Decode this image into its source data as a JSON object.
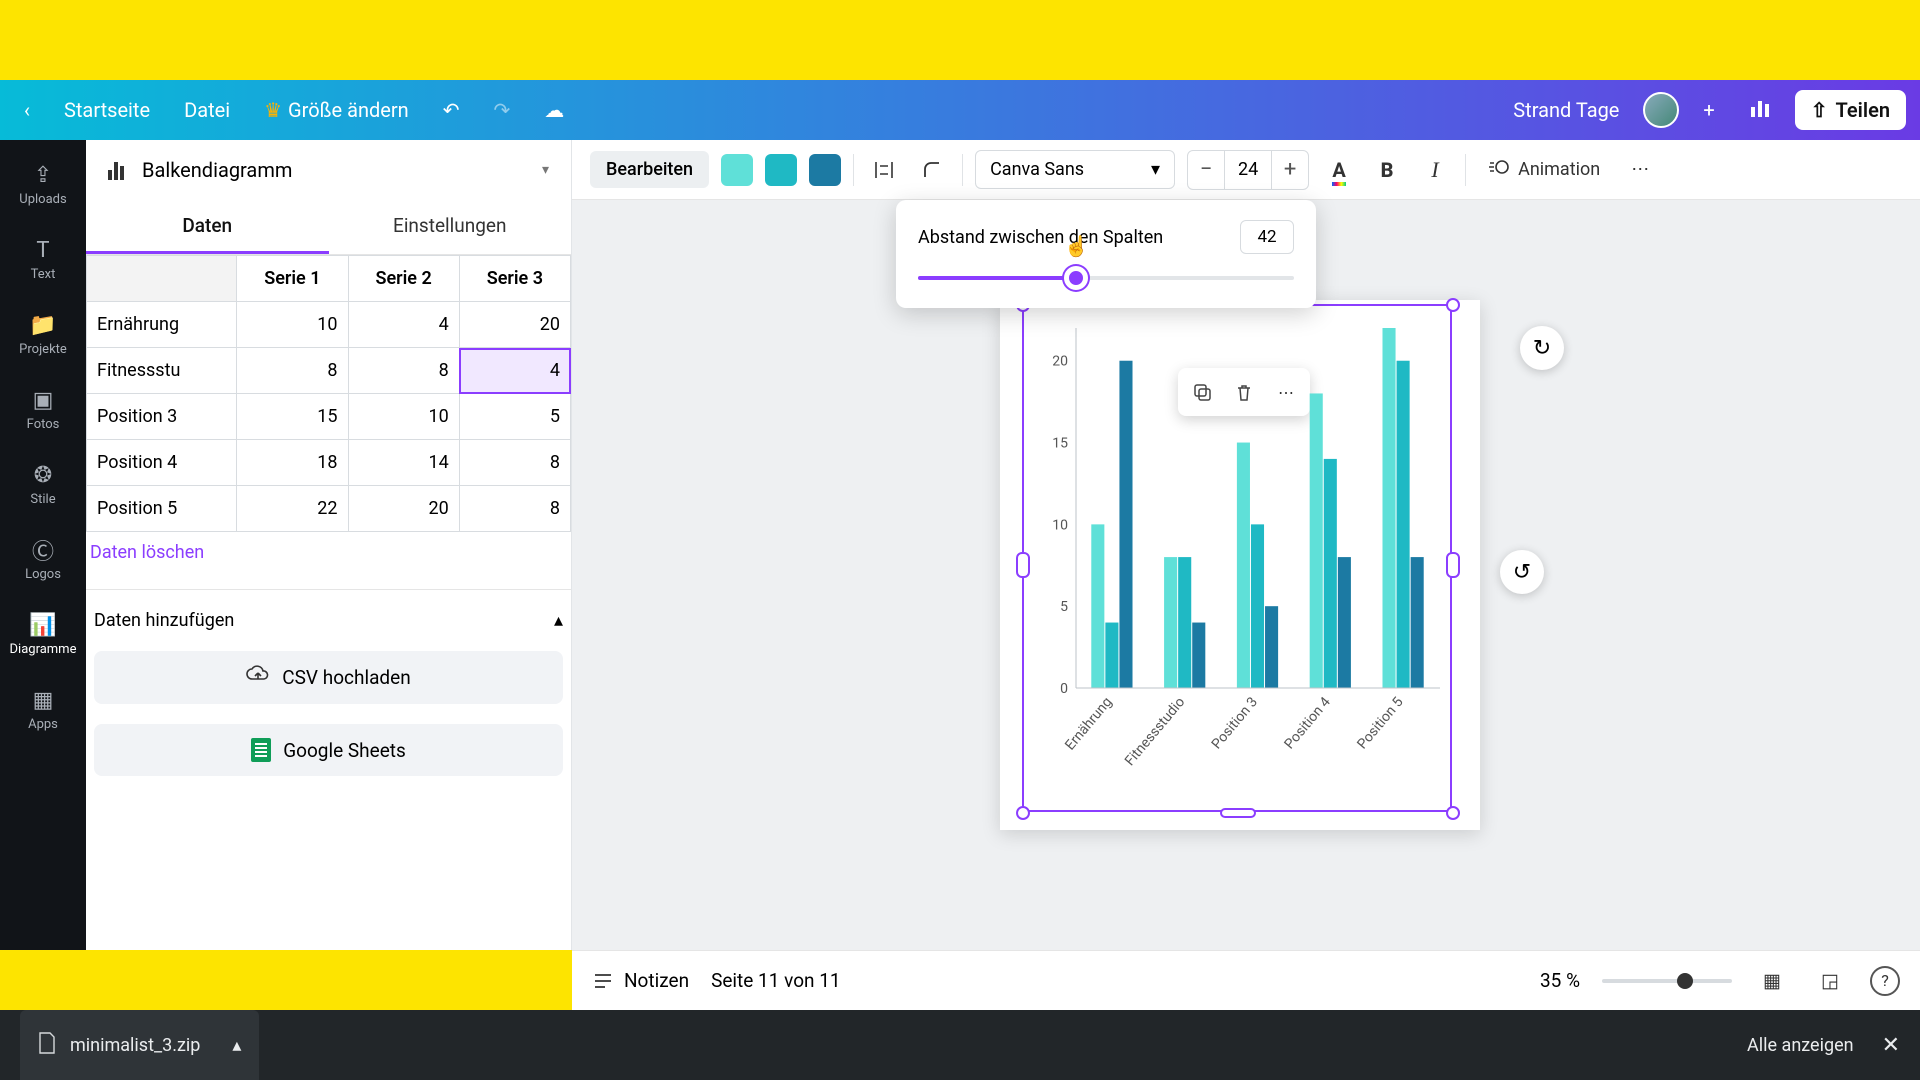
{
  "topbar": {
    "home": "Startseite",
    "file": "Datei",
    "resize": "Größe ändern",
    "doc_title": "Strand Tage",
    "share": "Teilen"
  },
  "rail": {
    "uploads": "Uploads",
    "text": "Text",
    "projects": "Projekte",
    "photos": "Fotos",
    "styles": "Stile",
    "logos": "Logos",
    "charts": "Diagramme",
    "apps": "Apps"
  },
  "sidepanel": {
    "chart_type": "Balkendiagramm",
    "tab_data": "Daten",
    "tab_settings": "Einstellungen",
    "headers": [
      "",
      "Serie 1",
      "Serie 2",
      "Serie 3"
    ],
    "rows": [
      {
        "label": "Ernährung",
        "c1": "10",
        "c2": "4",
        "c3": "20"
      },
      {
        "label": "Fitnessstu",
        "c1": "8",
        "c2": "8",
        "c3": "4"
      },
      {
        "label": "Position 3",
        "c1": "15",
        "c2": "10",
        "c3": "5"
      },
      {
        "label": "Position 4",
        "c1": "18",
        "c2": "14",
        "c3": "8"
      },
      {
        "label": "Position 5",
        "c1": "22",
        "c2": "20",
        "c3": "8"
      }
    ],
    "clear": "Daten löschen",
    "add_data": "Daten hinzufügen",
    "upload_csv": "CSV hochladen",
    "google_sheets": "Google Sheets"
  },
  "ctxbar": {
    "edit": "Bearbeiten",
    "font": "Canva Sans",
    "font_size": "24",
    "animation": "Animation"
  },
  "popover": {
    "label": "Abstand zwischen den Spalten",
    "value": "42"
  },
  "colors": {
    "s1": "#5fe0d8",
    "s2": "#1fb9c4",
    "s3": "#1c7aa3"
  },
  "chart_data": {
    "type": "bar",
    "categories": [
      "Ernährung",
      "Fitnessstudio",
      "Position 3",
      "Position 4",
      "Position 5"
    ],
    "series": [
      {
        "name": "Serie 1",
        "values": [
          10,
          8,
          15,
          18,
          22
        ]
      },
      {
        "name": "Serie 2",
        "values": [
          4,
          8,
          10,
          14,
          20
        ]
      },
      {
        "name": "Serie 3",
        "values": [
          20,
          4,
          5,
          8,
          8
        ]
      }
    ],
    "ylim": [
      0,
      22
    ],
    "yticks": [
      0,
      5,
      10,
      15,
      20
    ],
    "xlabel": "",
    "ylabel": ""
  },
  "status": {
    "notes": "Notizen",
    "page": "Seite 11 von 11",
    "zoom": "35 %"
  },
  "download": {
    "file": "minimalist_3.zip",
    "show_all": "Alle anzeigen"
  }
}
